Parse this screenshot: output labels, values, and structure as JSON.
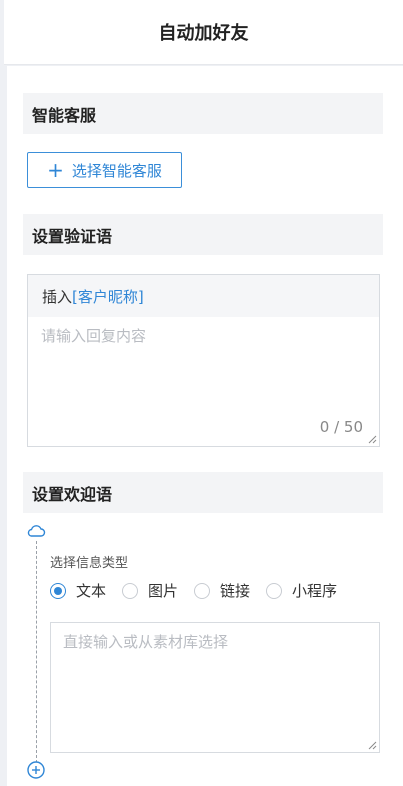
{
  "header": {
    "title": "自动加好友"
  },
  "smart_service": {
    "title": "智能客服",
    "button_icon": "+",
    "button_label": "选择智能客服"
  },
  "verification": {
    "title": "设置验证语",
    "insert_label": "插入",
    "insert_token": "[客户昵称]",
    "placeholder": "请输入回复内容",
    "counter": "0 / 50"
  },
  "welcome": {
    "title": "设置欢迎语",
    "message_type_label": "选择信息类型",
    "options": [
      "文本",
      "图片",
      "链接",
      "小程序"
    ],
    "selected": "文本",
    "content_placeholder": "直接输入或从素材库选择"
  },
  "colors": {
    "accent": "#2f86d6",
    "section_bg": "#f3f4f6",
    "border": "#d7dbe0"
  }
}
